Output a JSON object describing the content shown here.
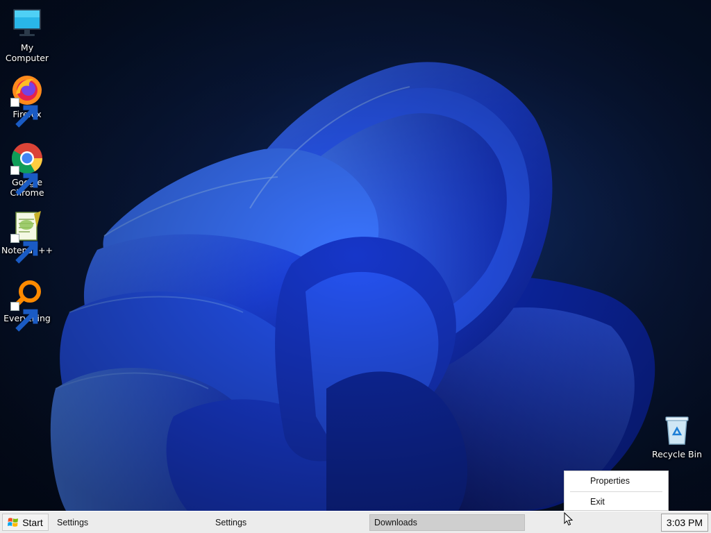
{
  "desktop": {
    "icons": [
      {
        "label": "My Computer",
        "icon": "monitor-icon"
      },
      {
        "label": "Firefox",
        "icon": "firefox-icon"
      },
      {
        "label": "Google Chrome",
        "icon": "chrome-icon"
      },
      {
        "label": "Notepad++",
        "icon": "notepadpp-icon"
      },
      {
        "label": "Everything",
        "icon": "everything-icon"
      },
      {
        "label": "Recycle Bin",
        "icon": "recycle-bin-icon"
      }
    ]
  },
  "context_menu": {
    "items": [
      {
        "label": "Properties"
      },
      {
        "label": "Exit"
      }
    ]
  },
  "taskbar": {
    "start_label": "Start",
    "tasks": [
      {
        "label": "Settings",
        "active": false
      },
      {
        "label": "Settings",
        "active": false
      },
      {
        "label": "Downloads",
        "active": true
      }
    ],
    "clock": "3:03 PM"
  },
  "colors": {
    "wallpaper_bg": "#07152e",
    "bloom_blue": "#1f4bff",
    "taskbar_bg": "#ececec",
    "active_task_bg": "#cfcfcf"
  }
}
